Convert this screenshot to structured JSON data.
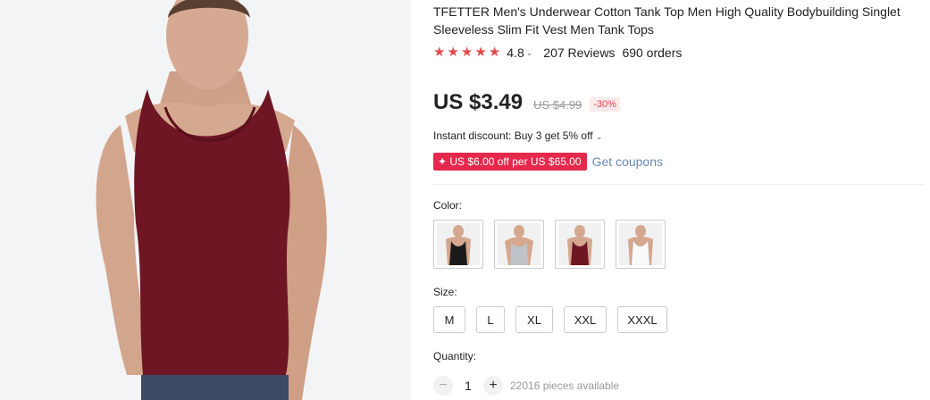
{
  "product": {
    "title": "TFETTER Men's Underwear Cotton Tank Top Men High Quality Bodybuilding Singlet Sleeveless Slim Fit Vest Men Tank Tops",
    "rating_value": "4.8",
    "rating_stars": 5,
    "reviews": "207 Reviews",
    "orders": "690 orders",
    "price": "US $3.49",
    "old_price": "US $4.99",
    "discount": "-30%",
    "instant_discount": "Instant discount: Buy 3 get 5% off",
    "coupon_badge": "✦ US $6.00 off per US $65.00",
    "get_coupons": "Get coupons",
    "color_label": "Color:",
    "size_label": "Size:",
    "sizes": [
      "M",
      "L",
      "XL",
      "XXL",
      "XXXL"
    ],
    "quantity_label": "Quantity:",
    "quantity": "1",
    "minus_symbol": "−",
    "plus_symbol": "+",
    "available": "22016 pieces available"
  },
  "colors": {
    "accent_red": "#e4294d",
    "star": "#e24a4a",
    "swatches": [
      "black",
      "gray",
      "burgundy",
      "white"
    ]
  },
  "icons": [
    "star-icon",
    "chevron-down-icon",
    "minus-icon",
    "plus-icon"
  ]
}
